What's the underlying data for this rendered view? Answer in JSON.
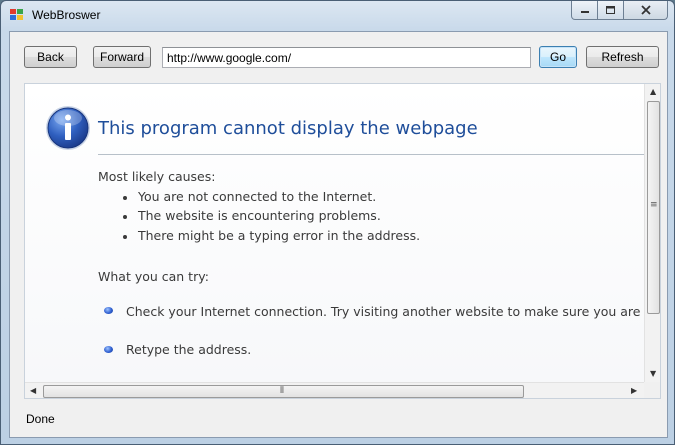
{
  "window": {
    "title": "WebBroswer"
  },
  "toolbar": {
    "back_label": "Back",
    "forward_label": "Forward",
    "address_value": "http://www.google.com/",
    "go_label": "Go",
    "refresh_label": "Refresh"
  },
  "page": {
    "heading": "This program cannot display the webpage",
    "causes_title": "Most likely causes:",
    "causes": [
      "You are not connected to the Internet.",
      "The website is encountering problems.",
      "There might be a typing error in the address."
    ],
    "try_title": "What you can try:",
    "try_items": [
      "Check your Internet connection. Try visiting another website to make sure you are co",
      "Retype the address."
    ]
  },
  "statusbar": {
    "text": "Done"
  },
  "colors": {
    "heading": "#1f4e9a",
    "info_icon": "#2f5fbf"
  }
}
